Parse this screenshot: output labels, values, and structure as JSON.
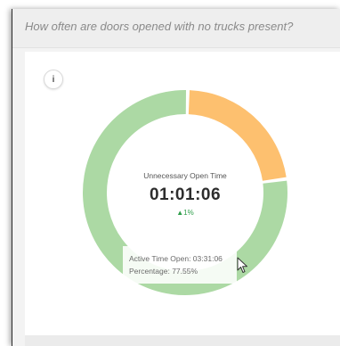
{
  "widget": {
    "title": "How often are doors opened with no trucks present?",
    "info_label": "i"
  },
  "chart_data": {
    "type": "pie",
    "categories": [
      "Unnecessary Open Time",
      "Active Time Open"
    ],
    "values": [
      22.45,
      77.55
    ],
    "colors": [
      "#fdc06f",
      "#acd9a4"
    ],
    "center": {
      "label": "Unnecessary Open Time",
      "value": "01:01:06",
      "delta": "1%",
      "delta_direction": "up"
    },
    "tooltip": {
      "line1": "Active Time Open: 03:31:06",
      "line2": "Percentage: 77.55%"
    }
  }
}
